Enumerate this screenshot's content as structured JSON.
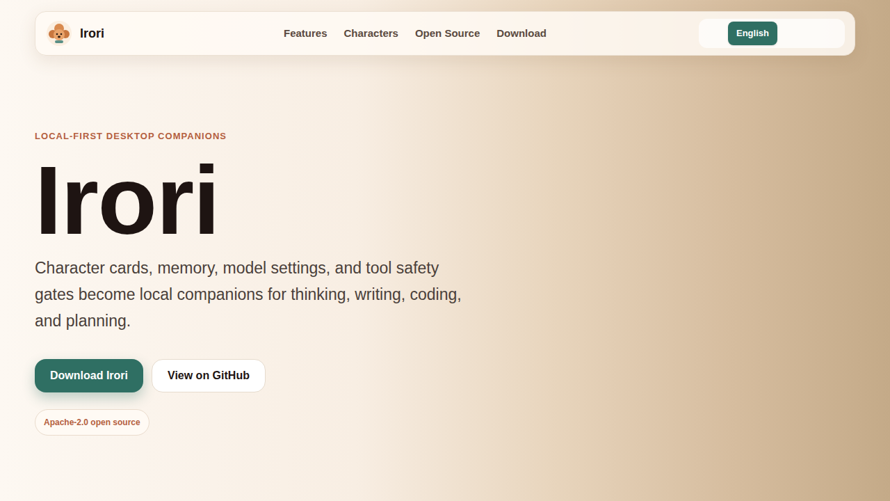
{
  "nav": {
    "brand": "Irori",
    "links": [
      {
        "label": "Features"
      },
      {
        "label": "Characters"
      },
      {
        "label": "Open Source"
      },
      {
        "label": "Download"
      }
    ],
    "languages": [
      {
        "label": "English",
        "selected": true
      }
    ]
  },
  "hero": {
    "eyebrow": "LOCAL-FIRST DESKTOP COMPANIONS",
    "title": "Irori",
    "description": "Character cards, memory, model settings, and tool safety gates become local companions for thinking, writing, coding, and planning.",
    "buttons": [
      {
        "label": "Download Irori",
        "kind": "primary"
      },
      {
        "label": "View on GitHub",
        "kind": "secondary"
      }
    ],
    "badge": "Apache-2.0 open source"
  }
}
